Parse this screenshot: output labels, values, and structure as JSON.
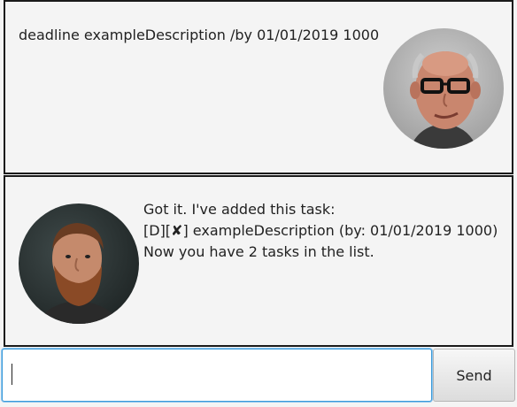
{
  "dialogs": [
    {
      "speaker": "user",
      "text": "deadline exampleDescription /by 01/01/2019 1000",
      "avatar_icon": "user-avatar-icon"
    },
    {
      "speaker": "bot",
      "text": "Got it. I've added this task:\n[D][✘] exampleDescription (by: 01/01/2019 1000)\nNow you have 2 tasks in the list.",
      "avatar_icon": "bot-avatar-icon"
    }
  ],
  "input": {
    "value": "",
    "placeholder": ""
  },
  "send_button": {
    "label": "Send"
  }
}
